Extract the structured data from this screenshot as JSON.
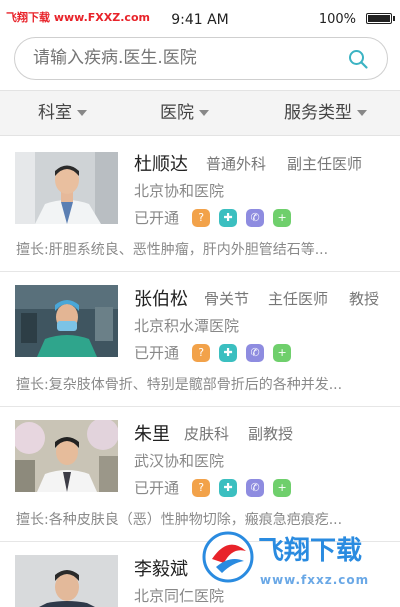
{
  "status_bar": {
    "watermark": "飞翔下载 www.FXXZ.com",
    "time": "9:41 AM",
    "battery": "100%"
  },
  "search": {
    "placeholder": "请输入疾病.医生.医院"
  },
  "filters": [
    {
      "label": "科室"
    },
    {
      "label": "医院"
    },
    {
      "label": "服务类型"
    }
  ],
  "doctors": [
    {
      "name": "杜顺达",
      "department": "普通外科",
      "title": "副主任医师",
      "extra_title": "",
      "hospital": "北京协和医院",
      "service_status": "已开通",
      "specialty": "擅长:肝胆系统良、恶性肿瘤，肝内外胆管结石等..."
    },
    {
      "name": "张伯松",
      "department": "骨关节",
      "title": "主任医师",
      "extra_title": "教授",
      "hospital": "北京积水潭医院",
      "service_status": "已开通",
      "specialty": "擅长:复杂肢体骨折、特别是髋部骨折后的各种并发..."
    },
    {
      "name": "朱里",
      "department": "皮肤科",
      "title": "副教授",
      "extra_title": "",
      "hospital": "武汉协和医院",
      "service_status": "已开通",
      "specialty": "擅长:各种皮肤良（恶）性肿物切除，瘢痕急疤痕疙..."
    },
    {
      "name": "李毅斌",
      "department": "",
      "title": "",
      "extra_title": "",
      "hospital": "北京同仁医院",
      "service_status": "",
      "specialty": ""
    }
  ],
  "service_icons": [
    "consult-icon",
    "clinic-icon",
    "phone-icon",
    "plus-icon"
  ],
  "watermark": {
    "logo_text": "飞翔下载",
    "url": "www.fxxz.com"
  },
  "colors": {
    "consult": "#f2a24a",
    "clinic": "#3bbfc0",
    "phone": "#8e8ce0",
    "plus": "#6fcf6c",
    "search_icon": "#3bb3c3",
    "watermark_red": "#e8232a",
    "watermark_blue": "#2a8be0"
  }
}
